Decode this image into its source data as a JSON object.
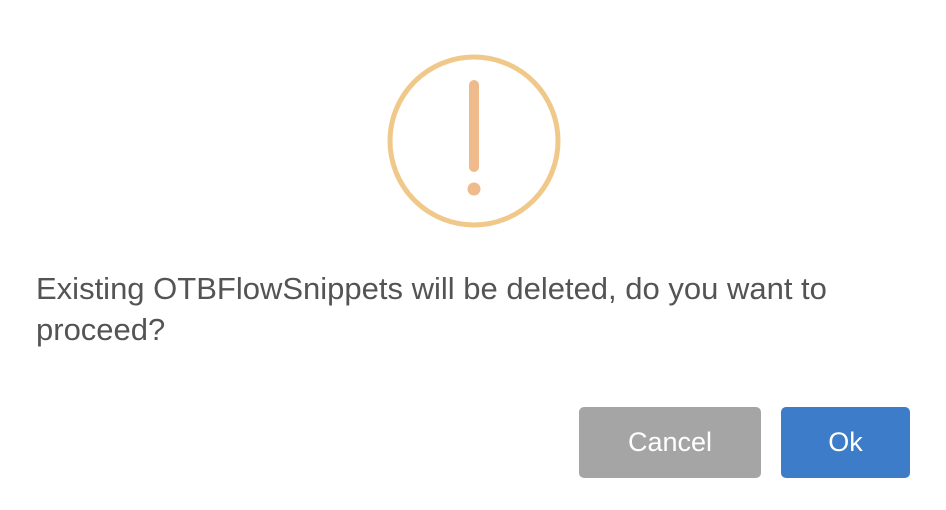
{
  "dialog": {
    "icon": "warning-exclamation-icon",
    "message": "Existing OTBFlowSnippets will be deleted, do you want to proceed?",
    "cancel_label": "Cancel",
    "ok_label": "Ok"
  },
  "colors": {
    "icon_ring": "#f0c88a",
    "icon_mark": "#f0bb8c",
    "message_text": "#545454",
    "cancel_bg": "#a5a5a5",
    "ok_bg": "#3c7cc8",
    "button_text": "#ffffff"
  }
}
